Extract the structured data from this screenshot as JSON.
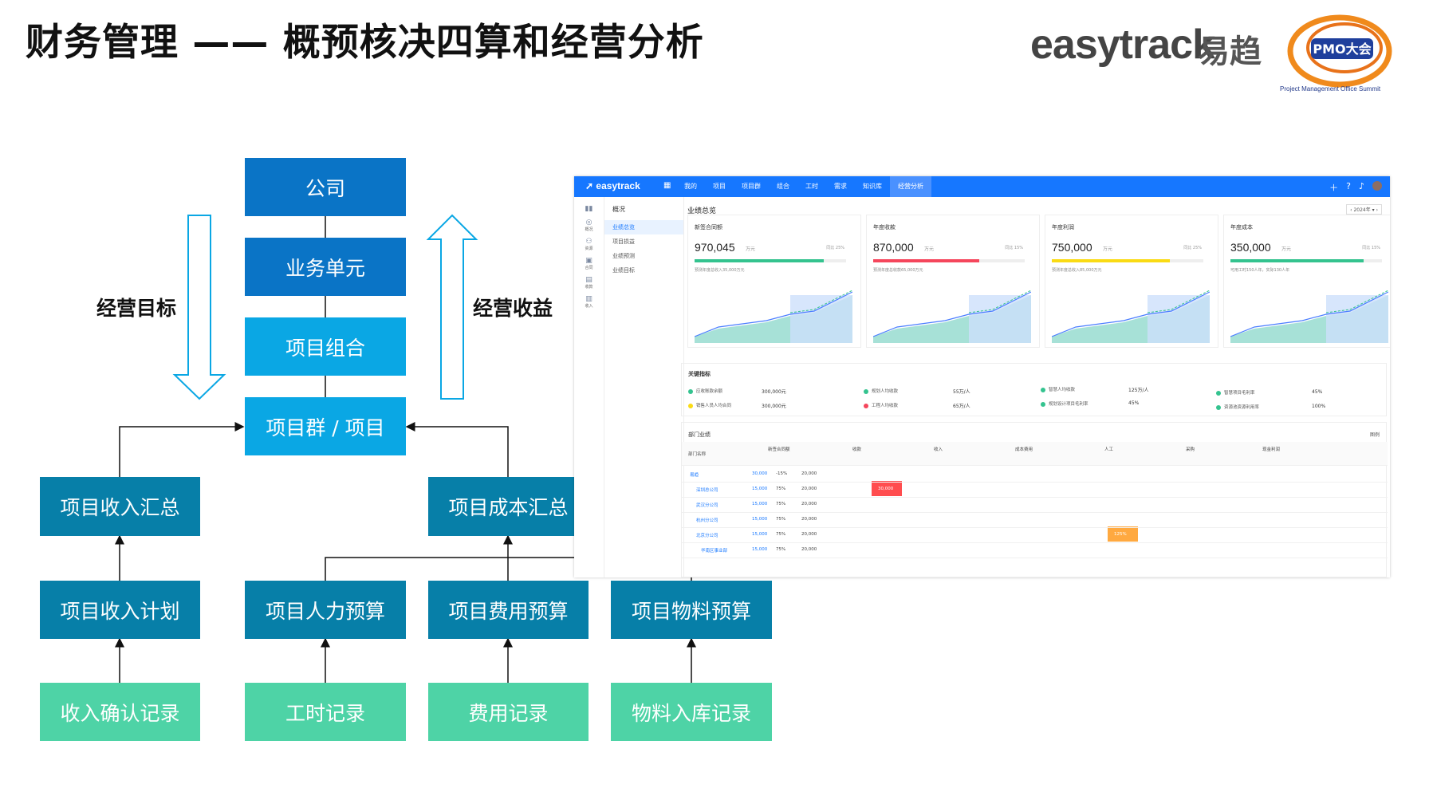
{
  "title": "财务管理 —— 概预核决四算和经营分析",
  "brand": {
    "name": "easytrack",
    "name_cn": "易趋",
    "pmo_badge": "PMO大会",
    "pmo_caption": "Project Management Office Summit"
  },
  "diagram": {
    "company": "公司",
    "business_unit": "业务单元",
    "portfolio": "项目组合",
    "program_project": "项目群 / 项目",
    "left_label": "经营目标",
    "right_label": "经营收益",
    "income_summary": "项目收入汇总",
    "cost_summary": "项目成本汇总",
    "income_plan": "项目收入计划",
    "labor_budget": "项目人力预算",
    "expense_budget": "项目费用预算",
    "material_budget": "项目物料预算",
    "income_record": "收入确认记录",
    "hours_record": "工时记录",
    "expense_record": "费用记录",
    "material_record": "物料入库记录"
  },
  "app": {
    "logo": "easytrack",
    "nav": [
      "我的",
      "项目",
      "项目群",
      "组合",
      "工时",
      "需求",
      "知识库",
      "经营分析"
    ],
    "rail": [
      "概况",
      "资源",
      "合同",
      "收款",
      "收入"
    ],
    "side_title": "概况",
    "side_items": [
      "业绩总览",
      "项目损益",
      "业绩预测",
      "业绩目标"
    ],
    "page_title": "业绩总览",
    "year": "2024年",
    "cards": [
      {
        "title": "新签合同额",
        "value": "970,045",
        "unit": "万元",
        "compare": "同比 25%",
        "note": "预测年度总收入35,000万元",
        "progress": 0.85,
        "color": "#34c38f"
      },
      {
        "title": "年度收款",
        "value": "870,000",
        "unit": "万元",
        "compare": "同比 15%",
        "note": "预测年度总收款65,000万元",
        "progress": 0.7,
        "color": "#f5465c"
      },
      {
        "title": "年度利润",
        "value": "750,000",
        "unit": "万元",
        "compare": "同比 25%",
        "note": "预测年度总收入85,000万元",
        "progress": 0.78,
        "color": "#fadb14"
      },
      {
        "title": "年度成本",
        "value": "350,000",
        "unit": "万元",
        "compare": "同比 15%",
        "note": "可用工时150人年，实际130人年",
        "progress": 0.88,
        "color": "#34c38f"
      }
    ],
    "kpi_title": "关键指标",
    "kpis": [
      {
        "label": "应收账款余额",
        "value": "300,000元",
        "dot": "#34c38f"
      },
      {
        "label": "销售人员人均合同",
        "value": "300,000元",
        "dot": "#fadb14"
      },
      {
        "label": "规划人均收款",
        "value": "55万/人",
        "dot": "#34c38f"
      },
      {
        "label": "工程人均收款",
        "value": "65万/人",
        "dot": "#f5465c"
      },
      {
        "label": "智慧人均收款",
        "value": "125万/人",
        "dot": "#34c38f"
      },
      {
        "label": "规划设计项目毛利率",
        "value": "45%",
        "dot": "#34c38f"
      },
      {
        "label": "智慧项目毛利率",
        "value": "45%",
        "dot": "#34c38f"
      },
      {
        "label": "资源池资源利用率",
        "value": "100%",
        "dot": "#34c38f"
      }
    ],
    "table_title": "部门业绩",
    "table_right": "图例",
    "groups": [
      "新签合同额",
      "收款",
      "收入",
      "成本费用",
      "人工",
      "采购",
      "现金利润"
    ],
    "dept_col": "部门名称",
    "rows": [
      {
        "name": "易趋",
        "a": "30,000",
        "b": "-15%",
        "c": "20,000"
      },
      {
        "name": "深圳总公司",
        "a": "15,000",
        "b": "75%",
        "c": "20,000"
      },
      {
        "name": "武汉分公司",
        "a": "15,000",
        "b": "75%",
        "c": "20,000"
      },
      {
        "name": "杭州分公司",
        "a": "15,000",
        "b": "75%",
        "c": "20,000"
      },
      {
        "name": "北京分公司",
        "a": "15,000",
        "b": "75%",
        "c": "20,000"
      },
      {
        "name": "华南区事业部",
        "a": "15,000",
        "b": "75%",
        "c": "20,000"
      }
    ],
    "highlight_red": "30,000",
    "highlight_orange": "125%"
  },
  "colors": {
    "dark": "#0a74c6",
    "cyan": "#0aa7e4",
    "teal": "#077fa8",
    "green": "#4ed3a6",
    "app_blue": "#1677ff"
  }
}
